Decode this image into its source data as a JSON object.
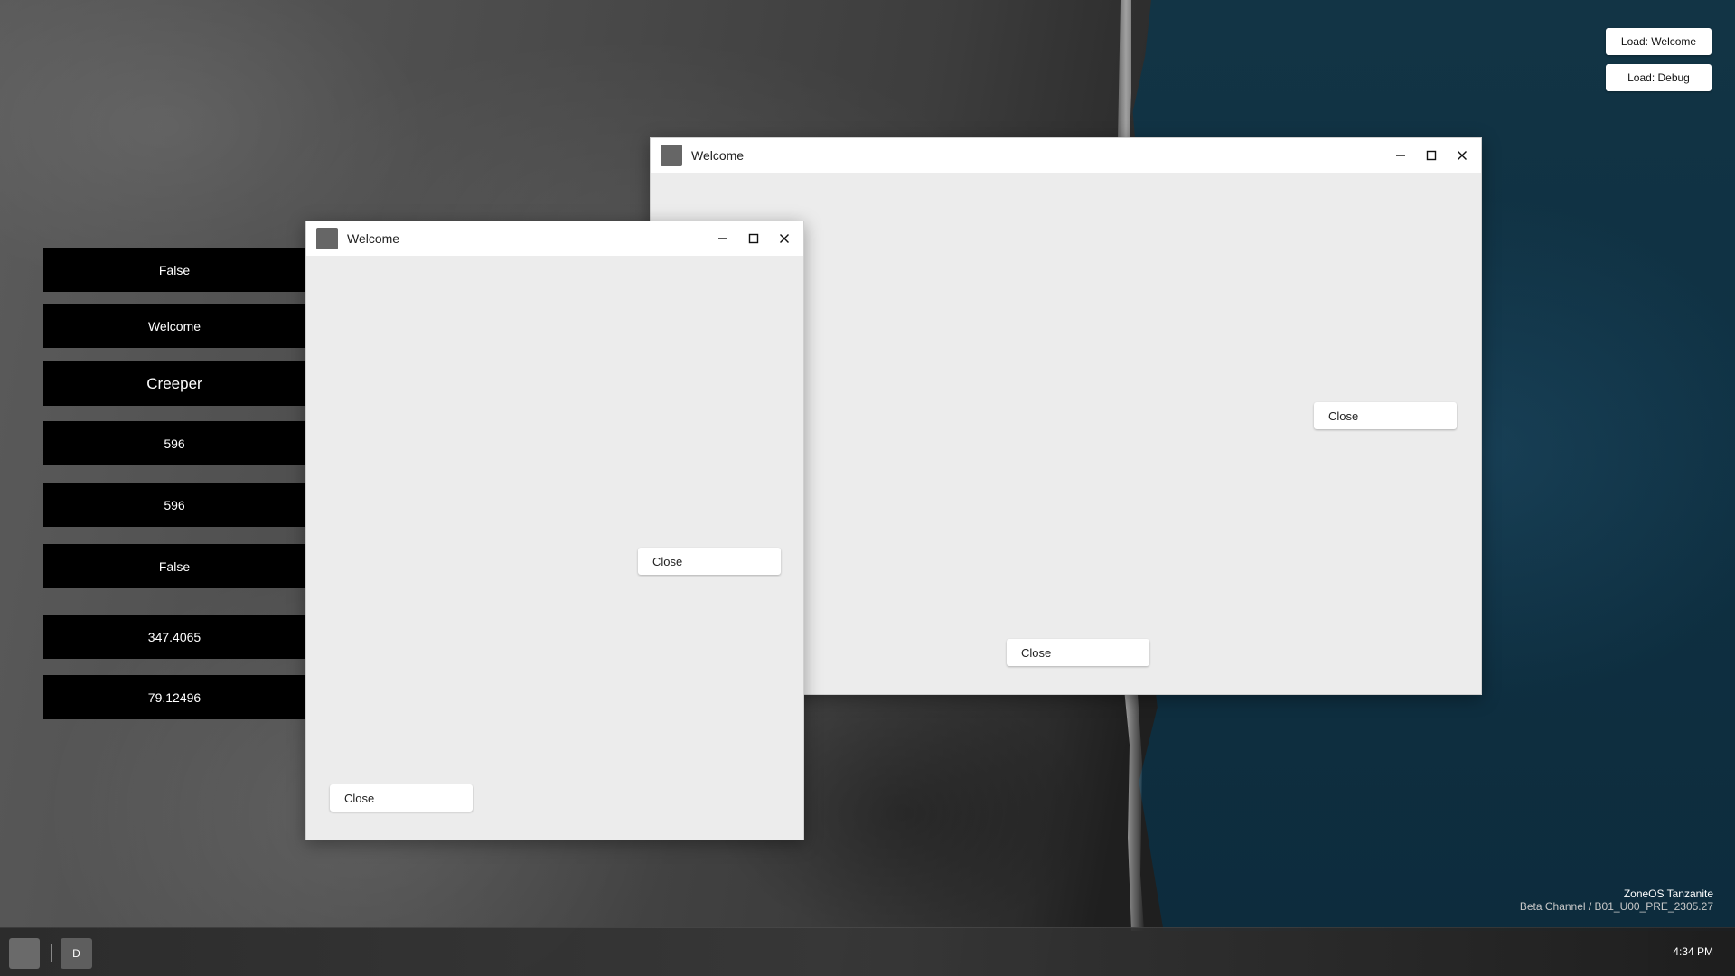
{
  "desktop": {
    "info_panels": [
      "False",
      "Welcome",
      "Creeper",
      "596",
      "596",
      "False",
      "347.4065",
      "79.12496"
    ],
    "load_buttons": [
      "Load: Welcome",
      "Load: Debug"
    ],
    "os_name": "ZoneOS Tanzanite",
    "os_build": "Beta Channel / B01_U00_PRE_2305.27"
  },
  "windows": [
    {
      "title": "Welcome",
      "buttons": [
        "Close",
        "Close"
      ]
    },
    {
      "title": "Welcome",
      "buttons": [
        "Close",
        "Close"
      ]
    }
  ],
  "taskbar": {
    "app_label": "D",
    "clock": "4:34 PM"
  },
  "icons": {
    "minimize": "minimize-icon",
    "maximize": "maximize-icon",
    "close": "close-icon"
  }
}
